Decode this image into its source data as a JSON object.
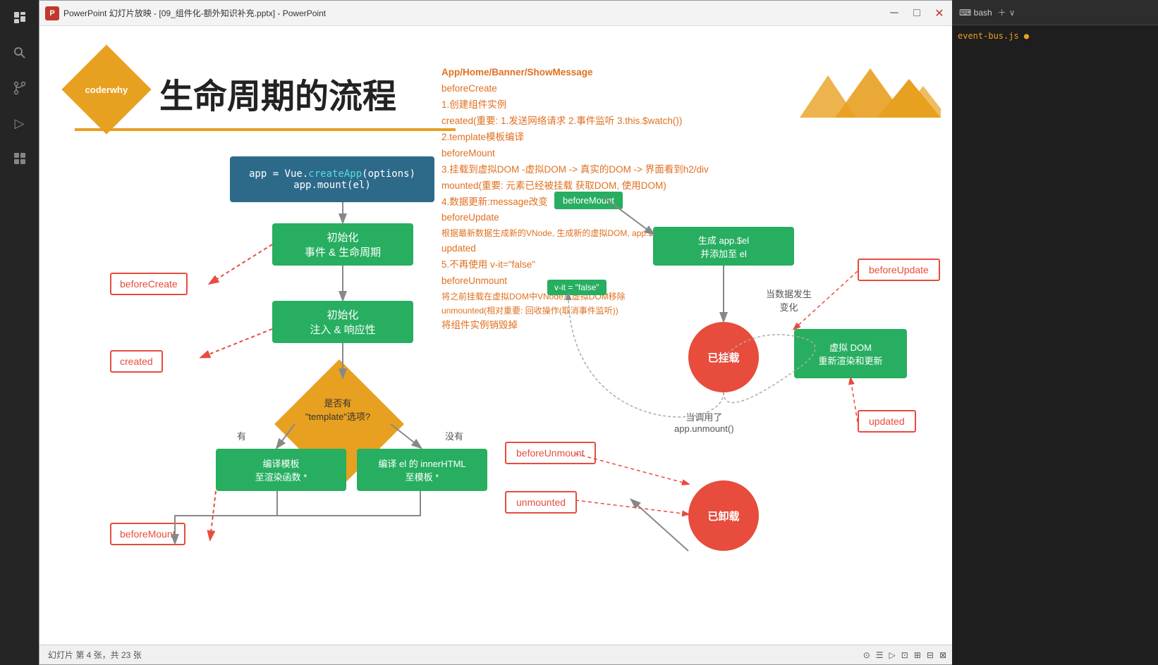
{
  "window": {
    "title": "PowerPoint 幻灯片放映 - [09_组件化-额外知识补充.pptx] - PowerPoint",
    "app_icon": "P",
    "min_btn": "─",
    "max_btn": "□",
    "close_btn": "✕"
  },
  "slide": {
    "logo_text": "coderwhy",
    "title": "生命周期的流程",
    "separator": "",
    "right_text_lines": [
      "App/Home/Banner/ShowMessage",
      "beforeCreate",
      "1.创建组件实例",
      "created(重要: 1.发送网络请求 2.事件监听 3.this.$watch())",
      "2.template模板编译",
      "beforeMount",
      "3.挂载到虚拟DOM -虚拟DOM -> 真实的DOM -> 界面看到h2/div",
      "mounted(重要: 元素已经被挂载 获取DOM, 使用DOM)",
      "4.数据更新:message改变",
      "beforeUpdate",
      "根据最新数据生成新的VNode, 生成新的虚拟DOM, app.$el 真实的DOM",
      "updated",
      "5.不再使用 v-it=\"false\"",
      "beforeUnmount",
      "将之前挂载在虚拟DOM中VNode从虚拟DOM移除",
      "unmounted(相对重要: 回收操作(取消事件监听))",
      "将组件实例销毁掉"
    ],
    "flowchart": {
      "code_box": {
        "line1": "app = Vue.createApp(options)",
        "line2": "app.mount(el)",
        "create_text": "createApp"
      },
      "init_box1": {
        "line1": "初始化",
        "line2": "事件 & 生命周期"
      },
      "init_box2": {
        "line1": "初始化",
        "line2": "注入 & 响应性"
      },
      "diamond_label": "是否有\n\"template\"选项?",
      "has_label": "有",
      "no_label": "没有",
      "compile_box1": {
        "line1": "编译模板",
        "line2": "至渲染函数 *"
      },
      "compile_box2": {
        "line1": "编译 el 的 innerHTML",
        "line2": "至模板 *"
      },
      "side_labels": {
        "beforeCreate": "beforeCreate",
        "created": "created",
        "beforeMount": "beforeMount"
      },
      "right_labels": {
        "beforeMount_inner": "beforeMount",
        "mounted_circle": "已挂载",
        "vnode_box_line1": "生成 app.$el",
        "vnode_box_line2": "并添加至 el",
        "data_change": "当数据发生\n变化",
        "vdom_box_line1": "虚拟 DOM",
        "vdom_box_line2": "重新渲染和更新",
        "beforeUpdate": "beforeUpdate",
        "updated": "updated",
        "unmount_text": "当调用了\napp.unmount()",
        "beforeUnmount": "beforeUnmount",
        "unmount_circle": "已卸载",
        "unmounted": "unmounted",
        "vif_label": "v-it = \"false\""
      }
    }
  },
  "statusbar": {
    "slide_info": "幻灯片 第 4 张，共 23 张"
  },
  "mountains": {
    "color": "#e8a020"
  }
}
